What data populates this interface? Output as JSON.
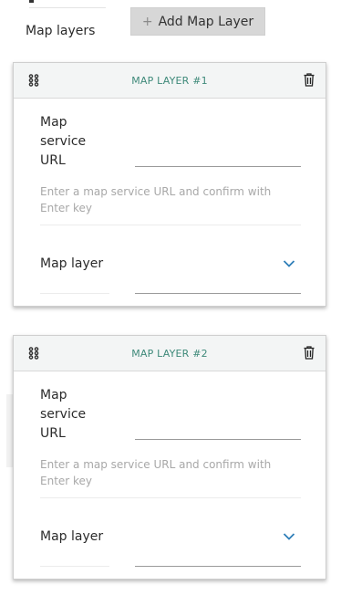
{
  "section": {
    "label": "Map layers",
    "add_button_label": "Add Map Layer",
    "add_button_icon": "plus-icon"
  },
  "layers": [
    {
      "title": "MAP LAYER #1",
      "url_label": "Map service URL",
      "url_value": "",
      "url_hint": "Enter a map service URL and confirm with Enter key",
      "layer_label": "Map layer",
      "layer_value": ""
    },
    {
      "title": "MAP LAYER #2",
      "url_label": "Map service URL",
      "url_value": "",
      "url_hint": "Enter a map service URL and confirm with Enter key",
      "layer_label": "Map layer",
      "layer_value": ""
    }
  ],
  "colors": {
    "header_title": "#3f8a7a",
    "chevron": "#2f7fb8",
    "button_bg": "#d7d7d7"
  },
  "icons": [
    "drag-handle-icon",
    "trash-icon",
    "chevron-down-icon",
    "plus-icon"
  ]
}
